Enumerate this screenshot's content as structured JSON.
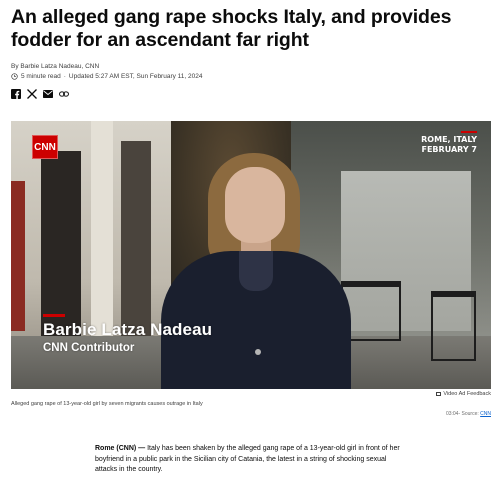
{
  "article": {
    "headline": "An alleged gang rape shocks Italy, and provides fodder for an ascendant far right",
    "byline": "By Barbie Latza Nadeau, CNN",
    "read_time": "5 minute read",
    "separator": "·",
    "updated": "Updated 5:27 AM EST, Sun February 11, 2024"
  },
  "share_icons": [
    "facebook-icon",
    "x-icon",
    "email-icon",
    "link-icon"
  ],
  "video": {
    "logo_text": "CNN",
    "location": "ROME, ITALY",
    "date": "FEBRUARY 7",
    "lower_third_name": "Barbie Latza Nadeau",
    "lower_third_title": "CNN Contributor",
    "ad_feedback": "Video Ad Feedback",
    "caption": "Alleged gang rape of 13-year-old girl by seven migrants causes outrage in Italy",
    "duration": "03:04",
    "source_prefix": "- Source: ",
    "source_link": "CNN"
  },
  "body": {
    "dateline": "Rome (CNN) —",
    "paragraph": " Italy has been shaken by the alleged gang rape of a 13-year-old girl in front of her boyfriend in a public park in the Sicilian city of Catania, the latest in a string of shocking sexual attacks in the country."
  },
  "colors": {
    "accent": "#cc0000",
    "link": "#0c63ce",
    "text": "#0c0c0c",
    "muted": "#404040"
  }
}
